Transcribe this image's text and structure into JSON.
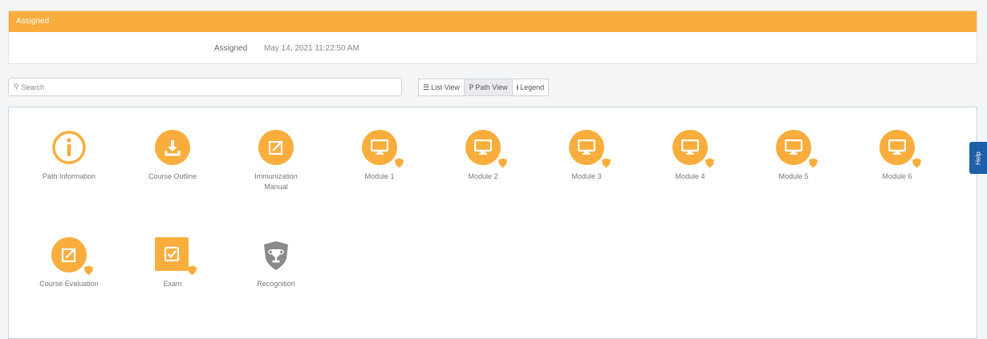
{
  "assigned": {
    "header": "Assigned",
    "label": "Assigned",
    "date": "May 14, 2021 11:22:50 AM"
  },
  "search": {
    "placeholder": "Search",
    "icon": "search-icon"
  },
  "views": [
    {
      "label": "List View",
      "icon": "list-icon"
    },
    {
      "label": "Path View",
      "icon": "path-icon",
      "active": true
    },
    {
      "label": "Legend",
      "icon": "info-icon"
    }
  ],
  "path_items": [
    {
      "label": "Path Information",
      "icon": "info-circle-icon"
    },
    {
      "label": "Course Outline",
      "icon": "download-icon"
    },
    {
      "label": "Immunization Manual",
      "icon": "external-link-icon"
    },
    {
      "label": "Module 1",
      "icon": "monitor-icon"
    },
    {
      "label": "Module 2",
      "icon": "monitor-icon"
    },
    {
      "label": "Module 3",
      "icon": "monitor-icon"
    },
    {
      "label": "Module 4",
      "icon": "monitor-icon"
    },
    {
      "label": "Module 5",
      "icon": "monitor-icon"
    },
    {
      "label": "Module 6",
      "icon": "monitor-icon"
    },
    {
      "label": "Course Evaluation",
      "icon": "external-link-icon"
    },
    {
      "label": "Exam",
      "icon": "checkbox-icon"
    },
    {
      "label": "Recognition",
      "icon": "trophy-shield-icon"
    }
  ],
  "help": {
    "label": "Help"
  },
  "colors": {
    "accent": "#f9ad3c",
    "help": "#1f5fa8",
    "recognition": "#8a8a8a"
  }
}
